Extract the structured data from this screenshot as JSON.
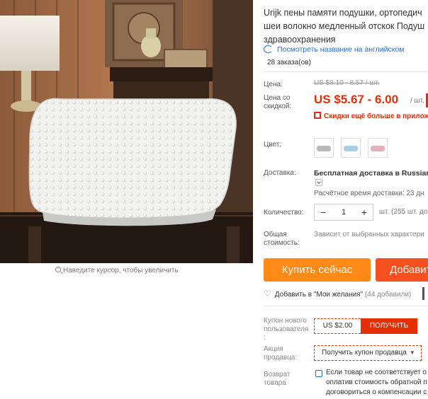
{
  "image": {
    "zoom_hint": "Наведите курсор, чтобы увеличить"
  },
  "product": {
    "title_lines": [
      "Urijk пены памяти подушки, ортопедич",
      "шеи волокно медленный отскок Подуш",
      "здравоохранения"
    ],
    "translate_link": "Посмотреть название на английском",
    "orders": "28 заказа(ов)"
  },
  "price": {
    "label": "Цена:",
    "old": "US $8.10 - 8.57 / шт.",
    "discount_label": "Цена со скидкой:",
    "new": "US $5.67 - 6.00",
    "per_unit": "/ шт.",
    "app_promo": "Скидки ещё больше в приложе"
  },
  "color": {
    "label": "Цвет:",
    "swatches": [
      {
        "name": "grey",
        "color": "#b9b9bb"
      },
      {
        "name": "blue",
        "color": "#a9cfe6"
      },
      {
        "name": "pink",
        "color": "#e7b0bd"
      }
    ]
  },
  "shipping": {
    "label": "Доставка:",
    "title": "Бесплатная доставка в Russian F",
    "time": "Расчётное время доставки: 23 дн"
  },
  "quantity": {
    "label": "Количество:",
    "minus": "−",
    "value": "1",
    "plus": "+",
    "note": "шт. (255 шт. до"
  },
  "total": {
    "label": "Общая стоимость:",
    "value": "Зависит от выбранных характери"
  },
  "actions": {
    "buy": "Купить сейчас",
    "cart": "Добавит",
    "wishlist": "Добавить в \"Мои желания\"",
    "wishlist_count": "(44 добавили)"
  },
  "coupons": {
    "new_user_label": "Купон нового пользователя :",
    "new_user_amount": "US $2.00",
    "new_user_get": "ПОЛУЧИТЬ",
    "seller_label": "Акция продавца:",
    "seller_button": "Получить купон продавца",
    "return_label": "Возврат товара",
    "return_lines": [
      "Если товар не соответствует о",
      "оплатив стоимость обратной п",
      "договориться о компенсации с"
    ]
  },
  "colors": {
    "price_red": "#e62e04",
    "buy_orange": "#ff8a18",
    "cart_orange": "#f4511e",
    "link_blue": "#2a6dcc"
  }
}
